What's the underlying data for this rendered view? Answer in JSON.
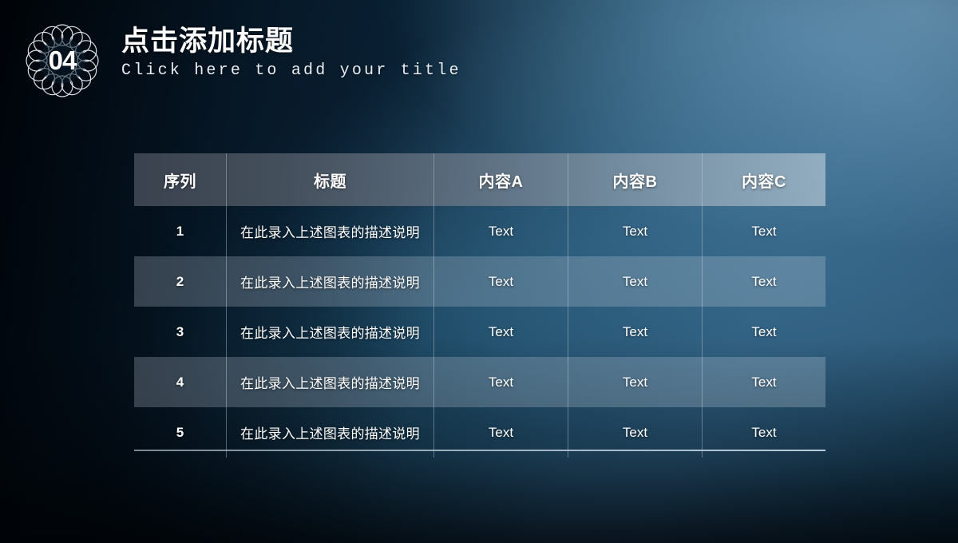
{
  "slide": {
    "section_number": "04",
    "title_cn": "点击添加标题",
    "title_en": "Click here to add your title",
    "badge_icon": "guilloche-ring-badge-icon"
  },
  "colors": {
    "background_dark": "#030c16",
    "background_mid": "#17455f",
    "background_light": "#4d7899",
    "header_row_left": "#3e4652",
    "header_row_right": "#9eb5c6",
    "text": "#ffffff",
    "grid_line": "#bed2e1"
  },
  "table": {
    "columns": [
      "序列",
      "标题",
      "内容A",
      "内容B",
      "内容C"
    ],
    "rows": [
      {
        "seq": "1",
        "title": "在此录入上述图表的描述说明",
        "a": "Text",
        "b": "Text",
        "c": "Text"
      },
      {
        "seq": "2",
        "title": "在此录入上述图表的描述说明",
        "a": "Text",
        "b": "Text",
        "c": "Text"
      },
      {
        "seq": "3",
        "title": "在此录入上述图表的描述说明",
        "a": "Text",
        "b": "Text",
        "c": "Text"
      },
      {
        "seq": "4",
        "title": "在此录入上述图表的描述说明",
        "a": "Text",
        "b": "Text",
        "c": "Text"
      },
      {
        "seq": "5",
        "title": "在此录入上述图表的描述说明",
        "a": "Text",
        "b": "Text",
        "c": "Text"
      }
    ]
  }
}
